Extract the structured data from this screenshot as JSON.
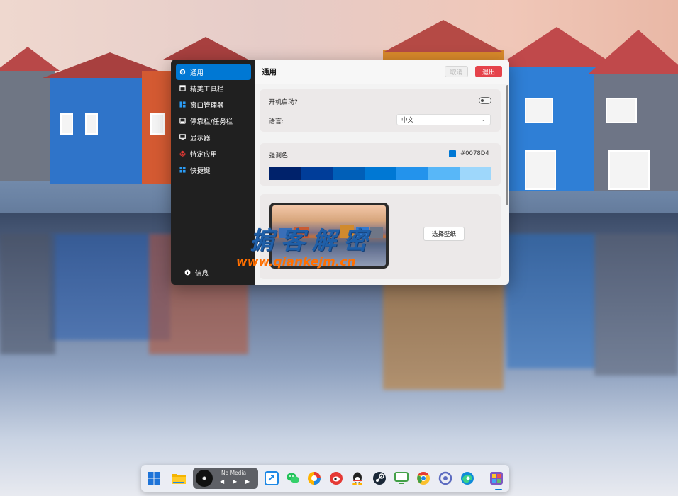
{
  "sidebar": {
    "items": [
      {
        "label": "通用",
        "icon": "gear-icon",
        "color": "#ffffff"
      },
      {
        "label": "精美工具栏",
        "icon": "window-icon",
        "color": "#ffffff"
      },
      {
        "label": "窗口管理器",
        "icon": "grid-icon",
        "color": "#2b9bf4"
      },
      {
        "label": "停靠栏/任务栏",
        "icon": "dock-icon",
        "color": "#ffffff"
      },
      {
        "label": "显示器",
        "icon": "monitor-icon",
        "color": "#ffffff"
      },
      {
        "label": "特定应用",
        "icon": "layers-icon",
        "color": "#e53935"
      },
      {
        "label": "快捷键",
        "icon": "apps-icon",
        "color": "#2b9bf4"
      }
    ],
    "footer": {
      "label": "信息",
      "icon": "info-icon"
    }
  },
  "header": {
    "title": "通用",
    "cancel_label": "取消",
    "exit_label": "退出"
  },
  "general": {
    "startup_label": "开机启动?",
    "startup_enabled": false,
    "language_label": "语言:",
    "language_value": "中文"
  },
  "accent": {
    "label": "强调色",
    "hex": "#0078D4",
    "palette": [
      "#00226b",
      "#003d99",
      "#005fb8",
      "#0078d4",
      "#2393ec",
      "#58b7f8",
      "#9ed7fb"
    ]
  },
  "wallpaper": {
    "select_label": "选择壁纸"
  },
  "watermark": {
    "title": "掮客解密",
    "url": "www.qiankejm.cn"
  },
  "dock": {
    "media_label": "No Media",
    "apps": [
      "start-icon",
      "folder-icon",
      "media-player",
      "remote-icon",
      "wechat-icon",
      "chrome-like-icon",
      "weibo-icon",
      "qq-icon",
      "steam-icon",
      "monitor-app-icon",
      "chrome-icon",
      "circle-app-icon",
      "edge-icon",
      "gallery-icon"
    ]
  }
}
